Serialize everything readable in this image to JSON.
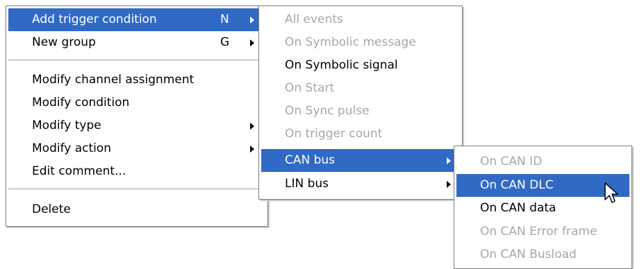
{
  "main_menu": {
    "items": [
      {
        "label": "Add trigger condition",
        "accel": "N"
      },
      {
        "label": "New group",
        "accel": "G"
      },
      {
        "label": "Modify channel assignment"
      },
      {
        "label": "Modify condition"
      },
      {
        "label": "Modify type"
      },
      {
        "label": "Modify action"
      },
      {
        "label": "Edit comment..."
      },
      {
        "label": "Delete"
      }
    ]
  },
  "trigger_submenu": {
    "items": [
      {
        "label": "All events"
      },
      {
        "label": "On Symbolic message"
      },
      {
        "label": "On Symbolic signal"
      },
      {
        "label": "On Start"
      },
      {
        "label": "On Sync pulse"
      },
      {
        "label": "On trigger count"
      },
      {
        "label": "CAN bus"
      },
      {
        "label": "LIN bus"
      }
    ]
  },
  "can_submenu": {
    "items": [
      {
        "label": "On CAN ID"
      },
      {
        "label": "On CAN DLC"
      },
      {
        "label": "On CAN data"
      },
      {
        "label": "On CAN Error frame"
      },
      {
        "label": "On CAN Busload"
      }
    ]
  },
  "colors": {
    "highlight": "#316ac5",
    "disabled_text": "#a7a6aa",
    "menu_border": "#7a7a7a"
  }
}
